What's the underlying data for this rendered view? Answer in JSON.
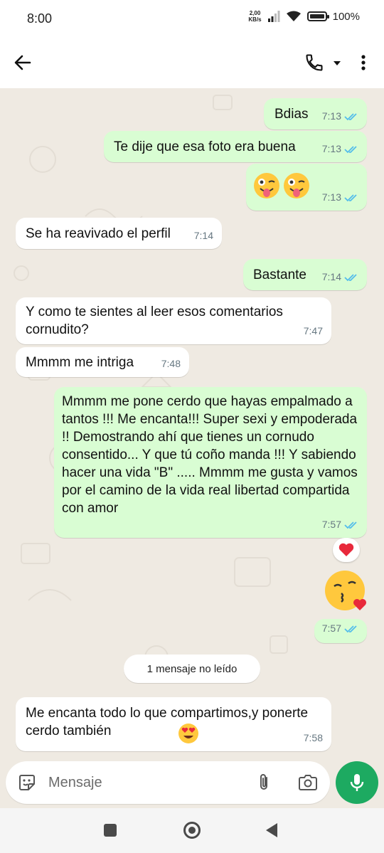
{
  "status_bar": {
    "time": "8:00",
    "net_speed_value": "2,00",
    "net_speed_unit": "KB/s",
    "battery": "100%",
    "icons": [
      "signal-icon",
      "wifi-icon",
      "battery-icon"
    ]
  },
  "app_bar": {
    "icons": [
      "back-arrow-icon",
      "phone-icon",
      "caret-down-icon",
      "more-vert-icon"
    ]
  },
  "messages": [
    {
      "dir": "out",
      "text": "Bdias",
      "time": "7:13",
      "read": true
    },
    {
      "dir": "out",
      "text": "Te dije que esa foto era buena",
      "time": "7:13",
      "read": true
    },
    {
      "dir": "out",
      "emoji": [
        "winking-face-with-tongue",
        "winking-face-with-tongue"
      ],
      "time": "7:13",
      "read": true
    },
    {
      "dir": "in",
      "text": "Se ha reavivado el perfil",
      "time": "7:14"
    },
    {
      "dir": "out",
      "text": "Bastante",
      "time": "7:14",
      "read": true
    },
    {
      "dir": "in",
      "text": "Y como te sientes al leer esos comentarios cornudito?",
      "time": "7:47"
    },
    {
      "dir": "in",
      "text": "Mmmm me intriga",
      "time": "7:48"
    },
    {
      "dir": "out",
      "text": "Mmmm me pone cerdo que hayas empalmado a tantos !!! Me encanta!!! Super sexi y empoderada !! Demostrando ahí que tienes un cornudo consentido... Y que tú coño manda !!! Y sabiendo hacer una vida \"B\" ..... Mmmm me gusta y vamos por el camino de la vida real libertad compartida con amor",
      "time": "7:57",
      "read": true,
      "reaction": "red-heart"
    },
    {
      "dir": "out",
      "emoji": [
        "face-blowing-a-kiss"
      ],
      "time": "7:57",
      "read": true
    },
    {
      "dir": "in",
      "text": "Me encanta todo lo que compartimos,y ponerte cerdo también",
      "emoji_after": "smiling-face-with-heart-eyes",
      "time": "7:58"
    }
  ],
  "unread_divider": "1 mensaje no leído",
  "composer": {
    "placeholder": "Mensaje",
    "icons": [
      "sticker-icon",
      "attach-icon",
      "camera-icon",
      "mic-icon"
    ]
  },
  "colors": {
    "outgoing_bubble": "#d9fdd3",
    "incoming_bubble": "#ffffff",
    "chat_background": "#efeae2",
    "accent_green": "#1daa61",
    "read_ticks": "#53bdeb"
  }
}
